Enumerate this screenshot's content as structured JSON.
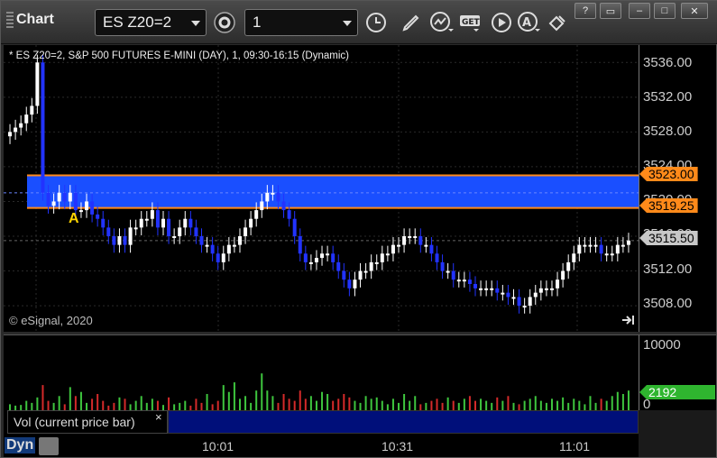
{
  "toolbar": {
    "title": "Chart",
    "symbol": "ES Z20=2",
    "interval": "1",
    "icons": [
      "settings-icon",
      "clock-icon",
      "pencil-icon",
      "study-icon",
      "get-icon",
      "play-icon",
      "alert-icon",
      "link-icon"
    ],
    "window_buttons": [
      "?",
      "▭",
      "–",
      "□",
      "✕"
    ]
  },
  "chart": {
    "header": "* ES Z20=2, S&P 500 FUTURES E-MINI (DAY), 1, 09:30-16:15 (Dynamic)",
    "copyright": "© eSignal, 2020",
    "marker_label": "A",
    "price_ticks": [
      "3536.00",
      "3532.00",
      "3528.00",
      "3524.00",
      "3520.00",
      "3516.00",
      "3512.00",
      "3508.00"
    ],
    "zone_top_label": "3523.00",
    "zone_bottom_label": "3519.25",
    "last_price_label": "3515.50",
    "colors": {
      "up": "#ffffff",
      "down": "#2233ff",
      "zone": "#1a4fff",
      "zone_line": "#ff8a1a",
      "last": "#c8c8c8"
    }
  },
  "volume": {
    "label": "Vol (current price bar)",
    "close": "×",
    "ticks": [
      "10000",
      "0"
    ],
    "current_label": "2192",
    "colors": {
      "up": "#3ec53e",
      "down": "#d42a2a",
      "current": "#2fb52f"
    }
  },
  "time_axis": {
    "ticks": [
      "10:01",
      "10:31",
      "11:01"
    ]
  },
  "footer": {
    "mode": "Dyn"
  },
  "chart_data": {
    "type": "candlestick",
    "y_range": [
      3505,
      3538
    ],
    "zone": {
      "top": 3523.0,
      "bottom": 3519.25
    },
    "last": 3515.5,
    "closes": [
      3528,
      3528.5,
      3529,
      3530,
      3531,
      3536,
      3521,
      3519.5,
      3520,
      3521,
      3520,
      3521,
      3519,
      3519,
      3520,
      3518.5,
      3518,
      3517,
      3516,
      3515,
      3516,
      3515,
      3517,
      3517,
      3518,
      3518,
      3519,
      3517,
      3518,
      3516,
      3516,
      3517,
      3518,
      3517,
      3516,
      3515,
      3515,
      3514,
      3513,
      3514,
      3515,
      3515,
      3516,
      3517,
      3518,
      3519,
      3520,
      3521,
      3521,
      3520,
      3519,
      3518,
      3516,
      3514,
      3513,
      3513,
      3513.5,
      3514,
      3514,
      3513,
      3512,
      3511,
      3510,
      3511,
      3512,
      3512,
      3513,
      3513,
      3514,
      3514,
      3515,
      3515,
      3516,
      3516,
      3516,
      3515,
      3515,
      3514,
      3513,
      3512,
      3512,
      3511,
      3511,
      3511,
      3510.5,
      3510,
      3510,
      3510,
      3510,
      3509.5,
      3509.5,
      3509,
      3509,
      3508,
      3508,
      3509,
      3509.5,
      3510,
      3510,
      3510,
      3511,
      3512,
      3513,
      3514,
      3515,
      3515,
      3515,
      3515,
      3514,
      3514,
      3514,
      3515,
      3515,
      3515.5
    ],
    "volumes_pct": [
      10,
      8,
      9,
      15,
      12,
      20,
      38,
      15,
      12,
      22,
      10,
      35,
      22,
      28,
      12,
      18,
      25,
      15,
      8,
      12,
      20,
      18,
      10,
      15,
      22,
      12,
      18,
      15,
      9,
      20,
      10,
      12,
      15,
      8,
      18,
      12,
      25,
      10,
      15,
      38,
      28,
      42,
      18,
      22,
      12,
      30,
      55,
      30,
      22,
      12,
      25,
      18,
      15,
      30,
      18,
      22,
      15,
      28,
      25,
      15,
      18,
      25,
      20,
      15,
      12,
      22,
      18,
      20,
      15,
      10,
      18,
      12,
      25,
      15,
      22,
      10,
      12,
      15,
      18,
      12,
      20,
      15,
      12,
      18,
      22,
      15,
      18,
      15,
      12,
      20,
      15,
      22,
      12,
      10,
      15,
      18,
      22,
      15,
      12,
      18,
      15,
      20,
      12,
      18,
      15,
      10,
      22,
      12,
      18,
      15,
      22,
      28,
      25,
      30
    ]
  }
}
